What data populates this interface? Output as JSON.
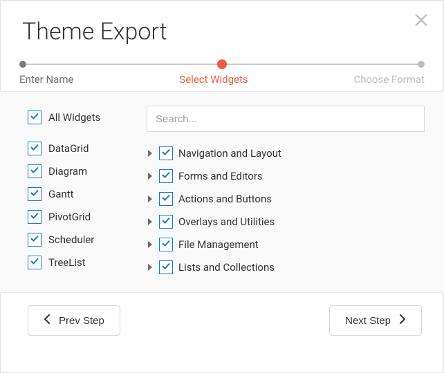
{
  "title": "Theme Export",
  "steps": {
    "s1": "Enter Name",
    "s2": "Select Widgets",
    "s3": "Choose Format"
  },
  "colors": {
    "accent": "#f05b41",
    "check_border": "#1378d5"
  },
  "left": {
    "all": "All Widgets",
    "items": [
      "DataGrid",
      "Diagram",
      "Gantt",
      "PivotGrid",
      "Scheduler",
      "TreeList"
    ]
  },
  "search": {
    "placeholder": "Search..."
  },
  "right": {
    "items": [
      "Navigation and Layout",
      "Forms and Editors",
      "Actions and Buttons",
      "Overlays and Utilities",
      "File Management",
      "Lists and Collections"
    ]
  },
  "buttons": {
    "prev": "Prev Step",
    "next": "Next Step"
  }
}
